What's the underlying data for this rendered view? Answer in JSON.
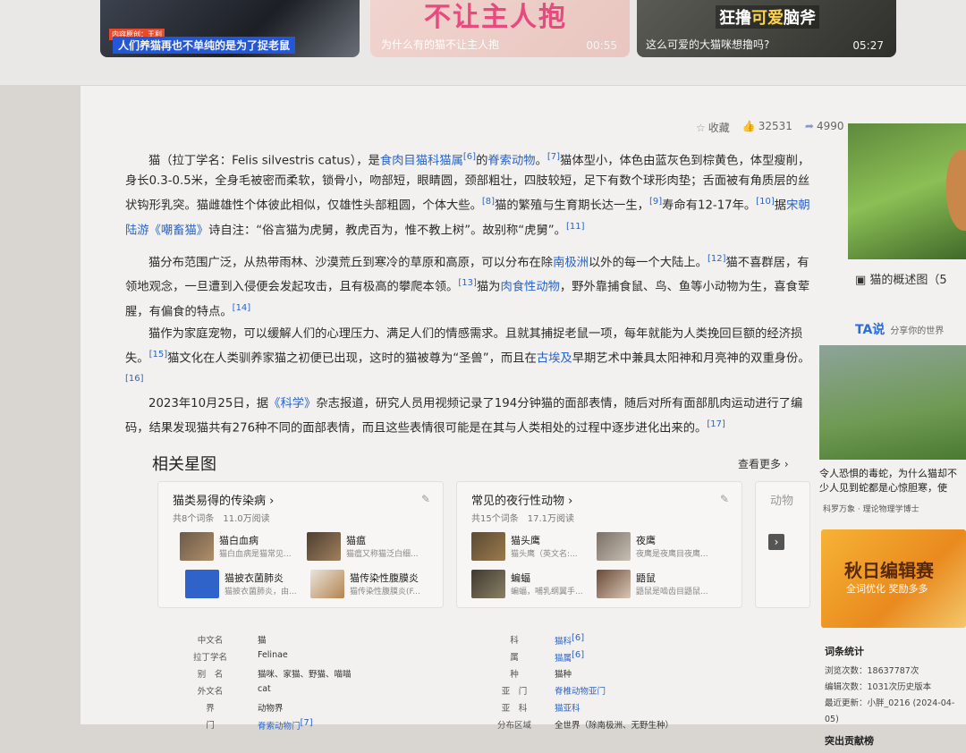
{
  "videos": [
    {
      "tag": "内容原创：王利",
      "caption": "人们养猫再也不单纯的是为了捉老鼠",
      "duration": ""
    },
    {
      "headline": "不让主人抱",
      "caption": "为什么有的猫不让主人抱",
      "duration": "00:55"
    },
    {
      "headline_a": "狂撸",
      "headline_b": "可爱",
      "headline_c": "脑斧",
      "caption": "这么可爱的大猫咪想撸吗?",
      "duration": "05:27"
    }
  ],
  "actions": {
    "favorite": "收藏",
    "likes": "32531",
    "shares": "4990"
  },
  "paragraphs": {
    "p1": {
      "a": "猫（拉丁学名：Felis silvestris catus），是",
      "link1": "食肉目猫科猫属",
      "s1": "[6]",
      "b": "的",
      "link2": "脊索动物",
      "c": "。",
      "s2": "[7]",
      "d": "猫体型小，体色由蓝灰色到棕黄色，体型瘦削，身长0.3-0.5米，全身毛被密而柔软，锁骨小，吻部短，眼睛圆，颈部粗壮，四肢较短，足下有数个球形肉垫；舌面被有角质层的丝状钩形乳突。猫雌雄性个体彼此相似，仅雄性头部粗圆，个体大些。",
      "s3": "[8]",
      "e": "猫的繁殖与生育期长达一生，",
      "s4": "[9]",
      "f": "寿命有12-17年。",
      "s5": "[10]",
      "g": "据",
      "link3": "宋朝陆游《嘲畜猫》",
      "h": "诗自注：“俗言猫为虎舅，教虎百为，惟不教上树”。故别称“虎舅”。",
      "s6": "[11]"
    },
    "p2": {
      "a": "猫分布范围广泛，从热带雨林、沙漠荒丘到寒冷的草原和高原，可以分布在除",
      "link1": "南极洲",
      "b": "以外的每一个大陆上。",
      "s1": "[12]",
      "c": "猫不喜群居，有领地观念，一旦遭到入侵便会发起攻击，且有极高的攀爬本领。",
      "s2": "[13]",
      "d": "猫为",
      "link2": "肉食性动物",
      "e": "，野外靠捕食鼠、鸟、鱼等小动物为生，喜食荤腥，有偏食的特点。",
      "s3": "[14]"
    },
    "p3": {
      "a": "猫作为家庭宠物，可以缓解人们的心理压力、满足人们的情感需求。且就其捕捉老鼠一项，每年就能为人类挽回巨额的经济损失。",
      "s1": "[15]",
      "b": "猫文化在人类驯养家猫之初便已出现，这时的猫被尊为“圣兽”，而且在",
      "link1": "古埃及",
      "c": "早期艺术中兼具太阳神和月亮神的双重身份。",
      "s2": "[16]"
    },
    "p4": {
      "a": "2023年10月25日，据",
      "link1": "《科学》",
      "b": "杂志报道，研究人员用视频记录了194分钟猫的面部表情，随后对所有面部肌肉运动进行了编码，结果发现猫共有276种不同的面部表情，而且这些表情很可能是在其与人类相处的过程中逐步进化出来的。",
      "s1": "[17]"
    }
  },
  "related": {
    "title": "相关星图",
    "more": "查看更多 ›",
    "cards": [
      {
        "title": "猫类易得的传染病 ›",
        "meta": "共8个词条　11.0万阅读",
        "items": [
          {
            "name": "猫白血病",
            "desc": "猫白血病是猫常见..."
          },
          {
            "name": "猫瘟",
            "desc": "猫瘟又称猫泛白细..."
          },
          {
            "name": "猫披衣菌肺炎",
            "desc": "猫披衣菌肺炎，由..."
          },
          {
            "name": "猫传染性腹膜炎",
            "desc": "猫传染性腹膜炎(F..."
          }
        ]
      },
      {
        "title": "常见的夜行性动物 ›",
        "meta": "共15个词条　17.1万阅读",
        "items": [
          {
            "name": "猫头鹰",
            "desc": "猫头鹰（英文名:..."
          },
          {
            "name": "夜鹰",
            "desc": "夜鹰是夜鹰目夜鹰..."
          },
          {
            "name": "蝙蝠",
            "desc": "蝙蝠，哺乳纲翼手..."
          },
          {
            "name": "鼯鼠",
            "desc": "鼯鼠是啮齿目鼯鼠..."
          }
        ]
      },
      {
        "title": "动物",
        "meta": ""
      }
    ]
  },
  "basic_info": [
    {
      "k1": "中文名",
      "v1": "猫",
      "k2": "科",
      "v2": "猫科",
      "s2": "[6]"
    },
    {
      "k1": "拉丁学名",
      "v1": "Felinae",
      "k2": "属",
      "v2": "猫属",
      "s2": "[6]"
    },
    {
      "k1": "别　名",
      "v1": "猫咪、家猫、野猫、喵喵",
      "k2": "种",
      "v2": "猫种"
    },
    {
      "k1": "外文名",
      "v1": "cat",
      "k2": "亚　门",
      "v2": "脊椎动物亚门"
    },
    {
      "k1": "界",
      "v1": "动物界",
      "k2": "亚　科",
      "v2": "猫亚科"
    },
    {
      "k1": "门",
      "v1": "脊索动物门",
      "s1": "[7]",
      "k2": "分布区域",
      "v2": "全世界（除南极洲、无野生种）"
    }
  ],
  "sidebar": {
    "album_caption": "猫的概述图（5",
    "ta_logo": "TA说",
    "ta_slogan": "分享你的世界",
    "ta_caption": "令人恐惧的毒蛇，为什么猫却不少人见到蛇都是心惊胆寒，使",
    "ta_source": "科罗万象 · 理论物理学博士",
    "banner_title": "秋日编辑赛",
    "banner_sub": "全词优化 奖励多多",
    "stats_title": "词条统计",
    "stats": [
      "浏览次数：18637787次",
      "编辑次数：1031次历史版本",
      "最近更新：小胖_0216 (2024-04-05)"
    ],
    "contrib": "突出贡献榜"
  }
}
